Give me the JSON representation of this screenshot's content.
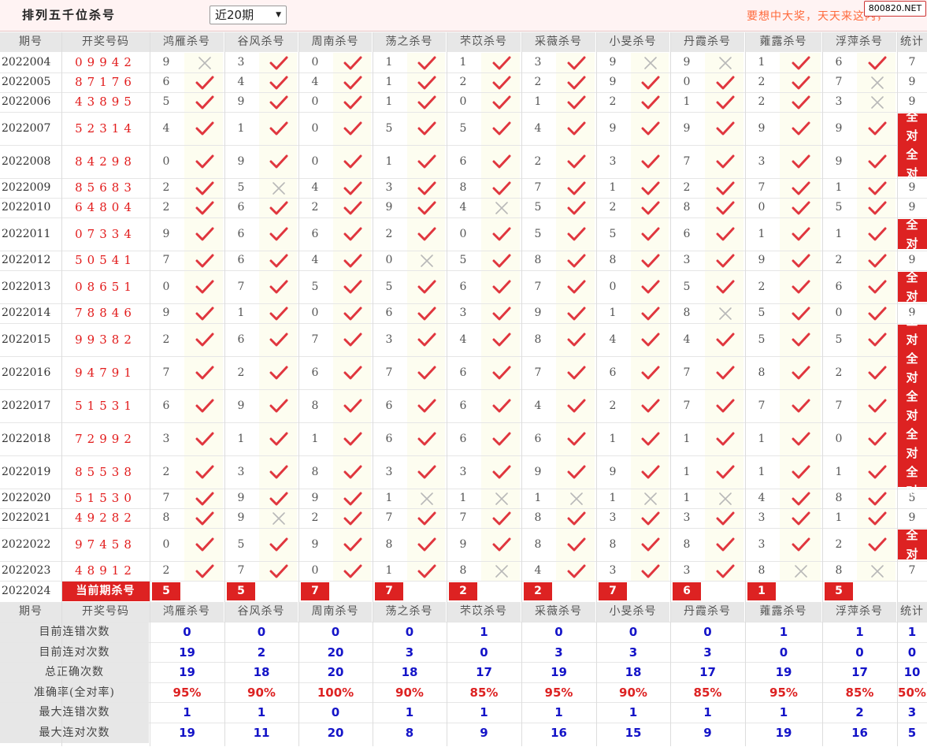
{
  "header": {
    "title": "排列五千位杀号",
    "range_selected": "近20期",
    "slogan": "要想中大奖，天天来这内，",
    "site_badge": "800820.NET"
  },
  "columns": {
    "period": "期号",
    "numbers": "开奖号码",
    "experts": [
      "鸿雁杀号",
      "谷风杀号",
      "周南杀号",
      "荡之杀号",
      "芣苡杀号",
      "采薇杀号",
      "小旻杀号",
      "丹霞杀号",
      "蕹露杀号",
      "浮萍杀号"
    ],
    "stat": "统计"
  },
  "all_right_char1": "全",
  "all_right_char2": "对",
  "rows": [
    {
      "period": "2022004",
      "numbers": "09942",
      "kills": [
        "9",
        "3",
        "0",
        "1",
        "1",
        "3",
        "9",
        "9",
        "1",
        "6"
      ],
      "marks": [
        "x",
        "v",
        "v",
        "v",
        "v",
        "v",
        "x",
        "x",
        "v",
        "v"
      ],
      "stat": "7"
    },
    {
      "period": "2022005",
      "numbers": "87176",
      "kills": [
        "6",
        "4",
        "4",
        "1",
        "2",
        "2",
        "9",
        "0",
        "2",
        "7"
      ],
      "marks": [
        "v",
        "v",
        "v",
        "v",
        "v",
        "v",
        "v",
        "v",
        "v",
        "x"
      ],
      "stat": "9"
    },
    {
      "period": "2022006",
      "numbers": "43895",
      "kills": [
        "5",
        "9",
        "0",
        "1",
        "0",
        "1",
        "2",
        "1",
        "2",
        "3"
      ],
      "marks": [
        "v",
        "v",
        "v",
        "v",
        "v",
        "v",
        "v",
        "v",
        "v",
        "x"
      ],
      "stat": "9"
    },
    {
      "period": "2022007",
      "numbers": "52314",
      "kills": [
        "4",
        "1",
        "0",
        "5",
        "5",
        "4",
        "9",
        "9",
        "9",
        "9"
      ],
      "marks": [
        "v",
        "v",
        "v",
        "v",
        "v",
        "v",
        "v",
        "v",
        "v",
        "v"
      ],
      "stat": ""
    },
    {
      "period": "2022008",
      "numbers": "84298",
      "kills": [
        "0",
        "9",
        "0",
        "1",
        "6",
        "2",
        "3",
        "7",
        "3",
        "9"
      ],
      "marks": [
        "v",
        "v",
        "v",
        "v",
        "v",
        "v",
        "v",
        "v",
        "v",
        "v"
      ],
      "stat": ""
    },
    {
      "period": "2022009",
      "numbers": "85683",
      "kills": [
        "2",
        "5",
        "4",
        "3",
        "8",
        "7",
        "1",
        "2",
        "7",
        "1"
      ],
      "marks": [
        "v",
        "x",
        "v",
        "v",
        "v",
        "v",
        "v",
        "v",
        "v",
        "v"
      ],
      "stat": "9"
    },
    {
      "period": "2022010",
      "numbers": "64804",
      "kills": [
        "2",
        "6",
        "2",
        "9",
        "4",
        "5",
        "2",
        "8",
        "0",
        "5"
      ],
      "marks": [
        "v",
        "v",
        "v",
        "v",
        "x",
        "v",
        "v",
        "v",
        "v",
        "v"
      ],
      "stat": "9"
    },
    {
      "period": "2022011",
      "numbers": "07334",
      "kills": [
        "9",
        "6",
        "6",
        "2",
        "0",
        "5",
        "5",
        "6",
        "1",
        "1"
      ],
      "marks": [
        "v",
        "v",
        "v",
        "v",
        "v",
        "v",
        "v",
        "v",
        "v",
        "v"
      ],
      "stat": ""
    },
    {
      "period": "2022012",
      "numbers": "50541",
      "kills": [
        "7",
        "6",
        "4",
        "0",
        "5",
        "8",
        "8",
        "3",
        "9",
        "2"
      ],
      "marks": [
        "v",
        "v",
        "v",
        "x",
        "v",
        "v",
        "v",
        "v",
        "v",
        "v"
      ],
      "stat": "9"
    },
    {
      "period": "2022013",
      "numbers": "08651",
      "kills": [
        "0",
        "7",
        "5",
        "5",
        "6",
        "7",
        "0",
        "5",
        "2",
        "6"
      ],
      "marks": [
        "v",
        "v",
        "v",
        "v",
        "v",
        "v",
        "v",
        "v",
        "v",
        "v"
      ],
      "stat": ""
    },
    {
      "period": "2022014",
      "numbers": "78846",
      "kills": [
        "9",
        "1",
        "0",
        "6",
        "3",
        "9",
        "1",
        "8",
        "5",
        "0"
      ],
      "marks": [
        "v",
        "v",
        "v",
        "v",
        "v",
        "v",
        "v",
        "x",
        "v",
        "v"
      ],
      "stat": "9"
    },
    {
      "period": "2022015",
      "numbers": "99382",
      "kills": [
        "2",
        "6",
        "7",
        "3",
        "4",
        "8",
        "4",
        "4",
        "5",
        "5"
      ],
      "marks": [
        "v",
        "v",
        "v",
        "v",
        "v",
        "v",
        "v",
        "v",
        "v",
        "v"
      ],
      "stat": ""
    },
    {
      "period": "2022016",
      "numbers": "94791",
      "kills": [
        "7",
        "2",
        "6",
        "7",
        "6",
        "7",
        "6",
        "7",
        "8",
        "2"
      ],
      "marks": [
        "v",
        "v",
        "v",
        "v",
        "v",
        "v",
        "v",
        "v",
        "v",
        "v"
      ],
      "stat": ""
    },
    {
      "period": "2022017",
      "numbers": "51531",
      "kills": [
        "6",
        "9",
        "8",
        "6",
        "6",
        "4",
        "2",
        "7",
        "7",
        "7"
      ],
      "marks": [
        "v",
        "v",
        "v",
        "v",
        "v",
        "v",
        "v",
        "v",
        "v",
        "v"
      ],
      "stat": ""
    },
    {
      "period": "2022018",
      "numbers": "72992",
      "kills": [
        "3",
        "1",
        "1",
        "6",
        "6",
        "6",
        "1",
        "1",
        "1",
        "0"
      ],
      "marks": [
        "v",
        "v",
        "v",
        "v",
        "v",
        "v",
        "v",
        "v",
        "v",
        "v"
      ],
      "stat": ""
    },
    {
      "period": "2022019",
      "numbers": "85538",
      "kills": [
        "2",
        "3",
        "8",
        "3",
        "3",
        "9",
        "9",
        "1",
        "1",
        "1"
      ],
      "marks": [
        "v",
        "v",
        "v",
        "v",
        "v",
        "v",
        "v",
        "v",
        "v",
        "v"
      ],
      "stat": ""
    },
    {
      "period": "2022020",
      "numbers": "51530",
      "kills": [
        "7",
        "9",
        "9",
        "1",
        "1",
        "1",
        "1",
        "1",
        "4",
        "8"
      ],
      "marks": [
        "v",
        "v",
        "v",
        "x",
        "x",
        "x",
        "x",
        "x",
        "v",
        "v"
      ],
      "stat": "5"
    },
    {
      "period": "2022021",
      "numbers": "49282",
      "kills": [
        "8",
        "9",
        "2",
        "7",
        "7",
        "8",
        "3",
        "3",
        "3",
        "1"
      ],
      "marks": [
        "v",
        "x",
        "v",
        "v",
        "v",
        "v",
        "v",
        "v",
        "v",
        "v"
      ],
      "stat": "9"
    },
    {
      "period": "2022022",
      "numbers": "97458",
      "kills": [
        "0",
        "5",
        "9",
        "8",
        "9",
        "8",
        "8",
        "8",
        "3",
        "2"
      ],
      "marks": [
        "v",
        "v",
        "v",
        "v",
        "v",
        "v",
        "v",
        "v",
        "v",
        "v"
      ],
      "stat": ""
    },
    {
      "period": "2022023",
      "numbers": "48912",
      "kills": [
        "2",
        "7",
        "0",
        "1",
        "8",
        "4",
        "3",
        "3",
        "8",
        "8"
      ],
      "marks": [
        "v",
        "v",
        "v",
        "v",
        "x",
        "v",
        "v",
        "v",
        "x",
        "x"
      ],
      "stat": "7"
    }
  ],
  "current": {
    "period": "2022024",
    "label": "当前期杀号",
    "kills": [
      "5",
      "5",
      "7",
      "7",
      "2",
      "2",
      "7",
      "6",
      "1",
      "5"
    ]
  },
  "summary": [
    {
      "label": "目前连错次数",
      "color": "blue",
      "values": [
        "0",
        "0",
        "0",
        "0",
        "1",
        "0",
        "0",
        "0",
        "1",
        "1",
        "1"
      ]
    },
    {
      "label": "目前连对次数",
      "color": "blue",
      "values": [
        "19",
        "2",
        "20",
        "3",
        "0",
        "3",
        "3",
        "3",
        "0",
        "0",
        "0"
      ]
    },
    {
      "label": "总正确次数",
      "color": "blue",
      "values": [
        "19",
        "18",
        "20",
        "18",
        "17",
        "19",
        "18",
        "17",
        "19",
        "17",
        "10"
      ]
    },
    {
      "label": "准确率(全对率)",
      "color": "red",
      "values": [
        "95%",
        "90%",
        "100%",
        "90%",
        "85%",
        "95%",
        "90%",
        "85%",
        "95%",
        "85%",
        "50%"
      ]
    },
    {
      "label": "最大连错次数",
      "color": "blue",
      "values": [
        "1",
        "1",
        "0",
        "1",
        "1",
        "1",
        "1",
        "1",
        "1",
        "2",
        "3"
      ]
    },
    {
      "label": "最大连对次数",
      "color": "blue",
      "values": [
        "19",
        "11",
        "20",
        "8",
        "9",
        "16",
        "15",
        "9",
        "19",
        "16",
        "5"
      ]
    }
  ],
  "colors": {
    "accent_red": "#dd2222",
    "header_gray": "#e7e7e7",
    "check_red": "#e0363e",
    "cross_gray": "#b8b8b8",
    "summary_blue": "#1414c8"
  }
}
